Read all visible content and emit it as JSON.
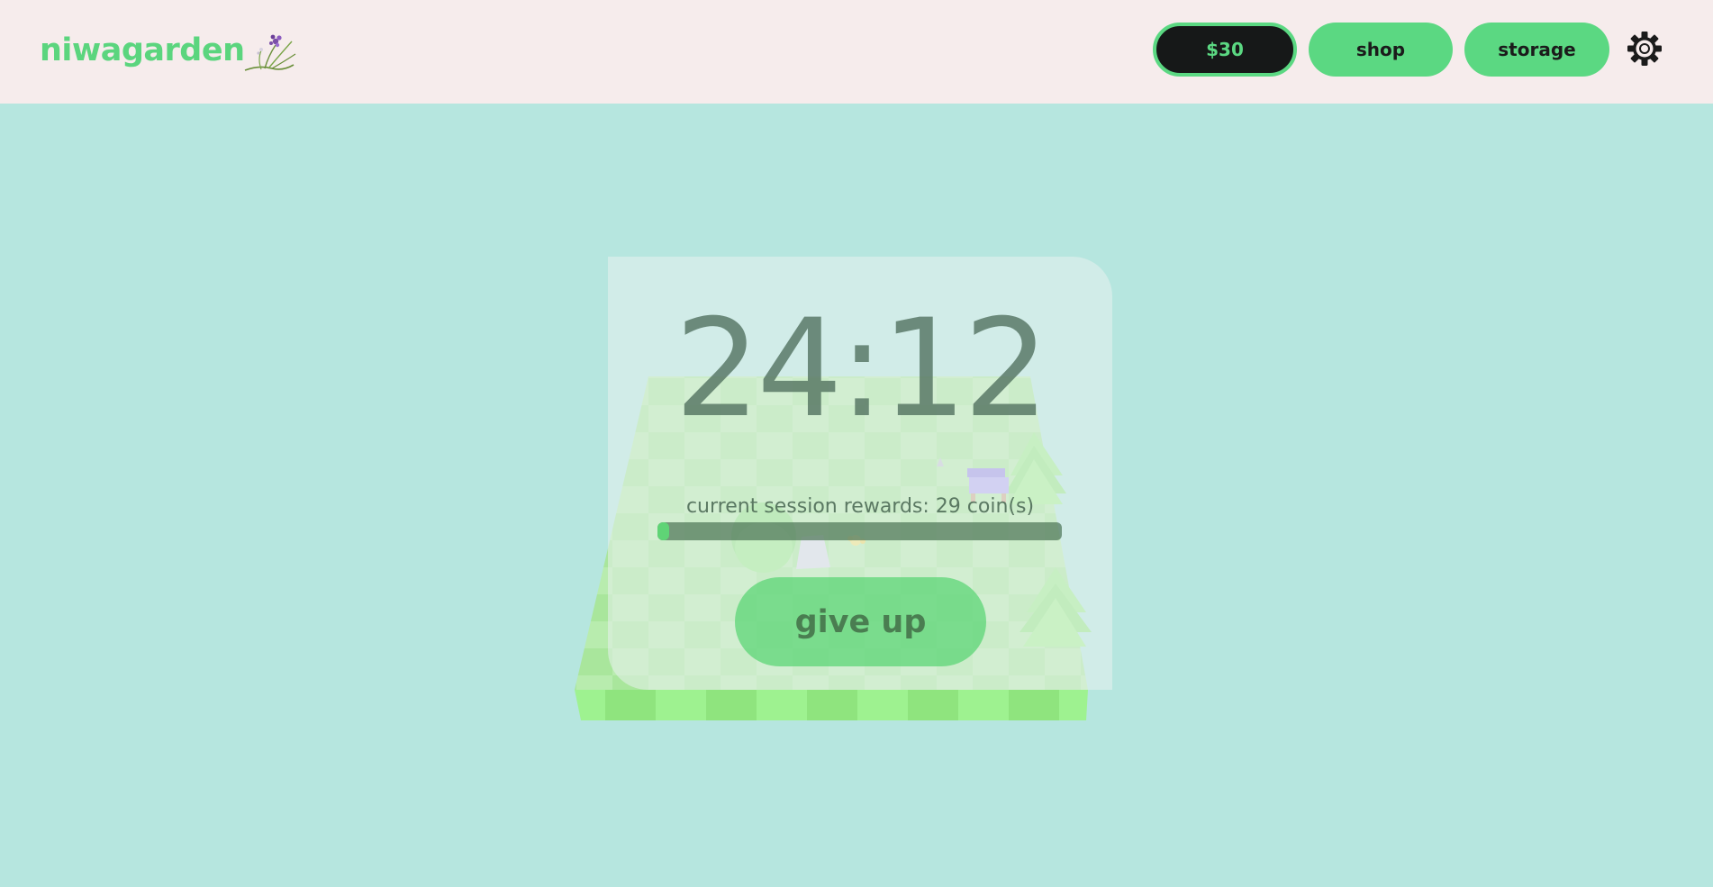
{
  "app": {
    "logo_text": "niwagarden"
  },
  "header": {
    "coins_label": "$30",
    "shop_label": "shop",
    "storage_label": "storage"
  },
  "session": {
    "timer": "24:12",
    "rewards_text": "current session rewards: 29 coin(s)",
    "progress_fraction": 0.03,
    "give_up_label": "give up"
  },
  "icons": {
    "settings": "gear-icon",
    "logo": "flower-plant-icon"
  },
  "colors": {
    "accent": "#5bd882",
    "background": "#b6e6df",
    "header_bg": "#f6ecec",
    "dark": "#161818"
  }
}
